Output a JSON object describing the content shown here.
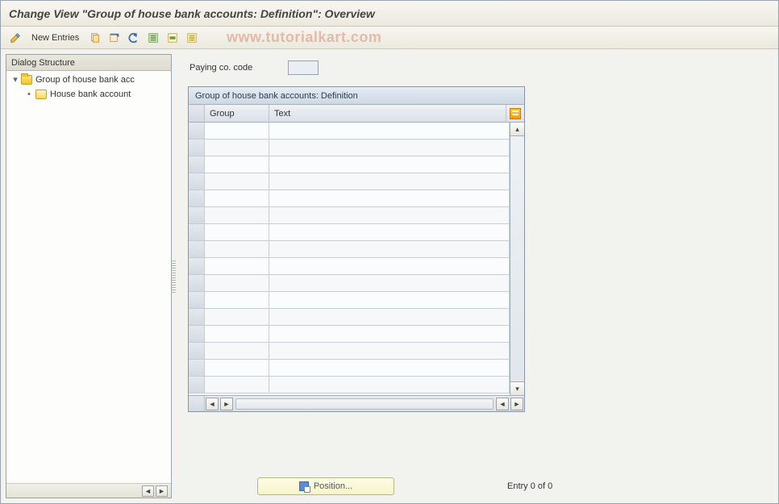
{
  "title": "Change View \"Group of house bank accounts: Definition\": Overview",
  "toolbar": {
    "new_entries_label": "New Entries",
    "icons": {
      "toggle": "toggle-display-change-icon",
      "copy": "copy-as-icon",
      "delete": "delete-icon",
      "undo": "undo-change-icon",
      "select_all": "select-all-icon",
      "select_block": "select-block-icon",
      "deselect_all": "deselect-all-icon"
    }
  },
  "watermark": "www.tutorialkart.com",
  "sidebar": {
    "header": "Dialog Structure",
    "items": [
      {
        "label": "Group of house bank acc",
        "expanded": true,
        "open": true
      },
      {
        "label": "House bank account",
        "expanded": false,
        "open": false
      }
    ]
  },
  "content": {
    "paying_co_code_label": "Paying co. code",
    "paying_co_code_value": ""
  },
  "grid": {
    "title": "Group of house bank accounts: Definition",
    "columns": {
      "group": "Group",
      "text": "Text"
    },
    "row_count": 16
  },
  "footer": {
    "position_label": "Position...",
    "entry_text": "Entry 0 of 0"
  }
}
